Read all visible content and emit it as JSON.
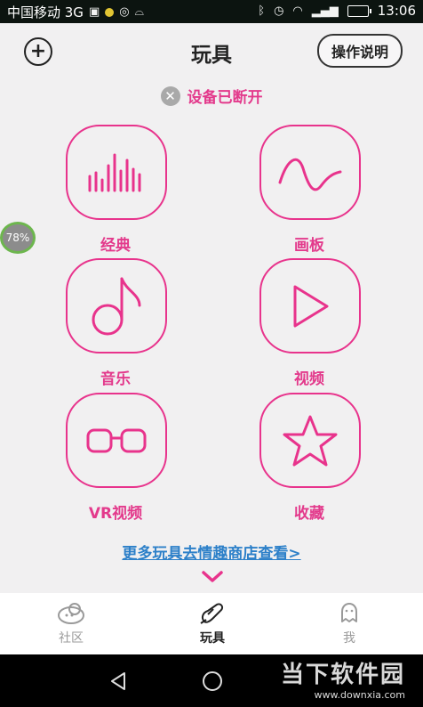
{
  "status_bar": {
    "carrier": "中国移动 3G",
    "signal_label": "3G",
    "time": "13:06"
  },
  "header": {
    "title": "玩具",
    "help_label": "操作说明"
  },
  "connection": {
    "text": "设备已断开"
  },
  "battery_badge": "78%",
  "tiles": [
    {
      "label": "经典",
      "icon": "equalizer-icon"
    },
    {
      "label": "画板",
      "icon": "wave-icon"
    },
    {
      "label": "音乐",
      "icon": "music-note-icon"
    },
    {
      "label": "视频",
      "icon": "play-icon"
    },
    {
      "label": "VR视频",
      "icon": "vr-glasses-icon"
    },
    {
      "label": "收藏",
      "icon": "star-icon"
    }
  ],
  "more_link": "更多玩具去情趣商店查看>",
  "tabbar": {
    "items": [
      {
        "label": "社区",
        "icon": "community-icon",
        "active": false
      },
      {
        "label": "玩具",
        "icon": "toy-icon",
        "active": true
      },
      {
        "label": "我",
        "icon": "profile-icon",
        "active": false
      }
    ]
  },
  "watermark": {
    "title": "当下软件园",
    "url": "www.downxia.com"
  },
  "colors": {
    "accent": "#e8338c",
    "link": "#2d80c9",
    "status_bar": "#0c1410"
  }
}
